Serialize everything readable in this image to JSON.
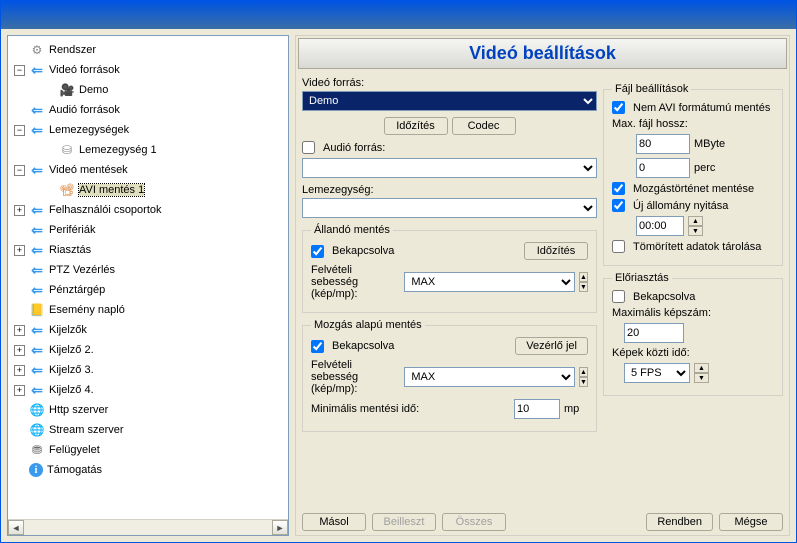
{
  "header_title": "Videó beállítások",
  "tree": {
    "rendszer": "Rendszer",
    "video_forrasok": "Videó források",
    "demo": "Demo",
    "audio_forrasok": "Audió források",
    "lemezegysegek": "Lemezegységek",
    "lemezegyseg1": "Lemezegység 1",
    "video_mentesek": "Videó mentések",
    "avi_mentes1": "AVI mentés 1",
    "felhasznalok": "Felhasználói csoportok",
    "periferiak": "Perifériák",
    "riasztas": "Riasztás",
    "ptz": "PTZ Vezérlés",
    "penztar": "Pénztárgép",
    "esemeny": "Esemény napló",
    "kijelzok": "Kijelzők",
    "kijelzo2": "Kijelző 2.",
    "kijelzo3": "Kijelző 3.",
    "kijelzo4": "Kijelző 4.",
    "http": "Http szerver",
    "stream": "Stream szerver",
    "felugyelet": "Felügyelet",
    "tamogatas": "Támogatás"
  },
  "labels": {
    "video_forras": "Videó forrás:",
    "idozites": "Időzítés",
    "codec": "Codec",
    "audio_forras": "Audió forrás:",
    "lemezegyseg": "Lemezegység:",
    "allando_mentes": "Állandó mentés",
    "bekapcsolva": "Bekapcsolva",
    "felveteli_seb": "Felvételi sebesség (kép/mp):",
    "mozgas_alapu": "Mozgás alapú mentés",
    "vezerlo_jel": "Vezérlő jel",
    "min_mentesi": "Minimális mentési idő:",
    "mp": "mp",
    "fajl_beallitasok": "Fájl beállítások",
    "nem_avi": "Nem AVI formátumú mentés",
    "max_fajl_hossz": "Max. fájl hossz:",
    "mbyte": "MByte",
    "perc": "perc",
    "mozgastortenet": "Mozgástörténet mentése",
    "uj_allomany": "Új állomány nyitása",
    "tomoritett": "Tömörített adatok tárolása",
    "eloriasztas": "Előriasztás",
    "max_kepszam": "Maximális képszám:",
    "kepek_kozti": "Képek közti idő:"
  },
  "values": {
    "video_forras_sel": "Demo",
    "audio_forras_checked": false,
    "allando_bekapcsolva": true,
    "allando_max": "MAX",
    "mozgas_bekapcsolva": true,
    "mozgas_max": "MAX",
    "min_mentesi_ido": "10",
    "nem_avi": true,
    "max_fajl_mbyte": "80",
    "max_fajl_perc": "0",
    "mozgastortenet": true,
    "uj_allomany": true,
    "uj_allomany_ido": "00:00",
    "tomoritett": false,
    "elor_bekapcsolva": false,
    "max_kepszam": "20",
    "kepek_kozti": "5 FPS"
  },
  "buttons": {
    "masol": "Másol",
    "beilleszt": "Beilleszt",
    "osszes": "Összes",
    "rendben": "Rendben",
    "megse": "Mégse"
  }
}
